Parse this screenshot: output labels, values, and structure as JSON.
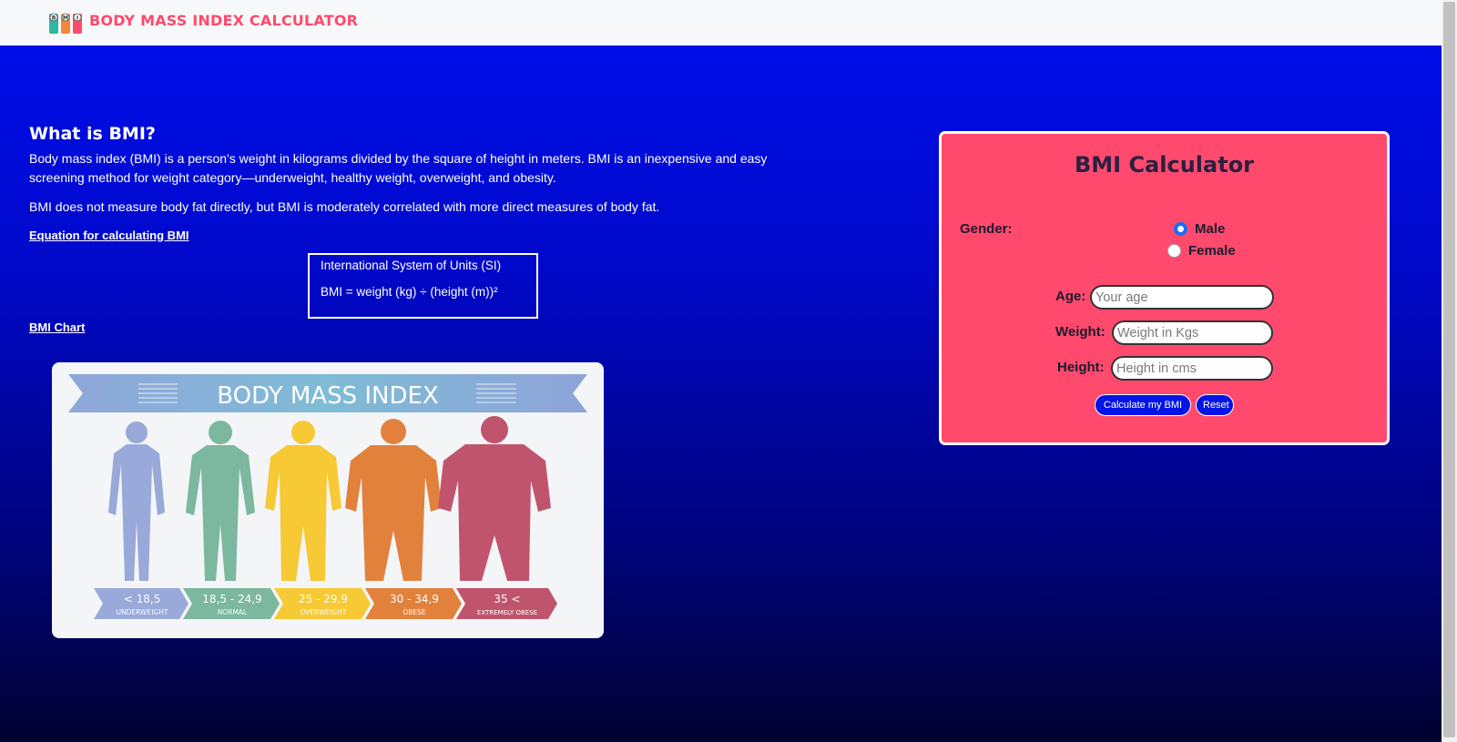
{
  "header": {
    "brand": "BODY MASS INDEX CALCULATOR",
    "logo_letters": "BMI",
    "brand_color": "#ff4a6e"
  },
  "intro": {
    "heading": "What is BMI?",
    "paragraph1": "Body mass index (BMI) is a person's weight in kilograms divided by the square of height in meters. BMI is an inexpensive and easy screening method for weight category—underweight, healthy weight, overweight, and obesity.",
    "paragraph2": "BMI does not measure body fat directly, but BMI is moderately correlated with more direct measures of body fat.",
    "equation_link": "Equation for calculating BMI",
    "equation": {
      "system": "International System of Units (SI)",
      "formula": "BMI = weight (kg) ÷ (height (m))²"
    },
    "chart_link": "BMI Chart"
  },
  "bmi_image": {
    "title": "BODY MASS INDEX",
    "categories": [
      {
        "range": "< 18,5",
        "label": "UNDERWEIGHT",
        "color": "#98a9da"
      },
      {
        "range": "18,5 - 24,9",
        "label": "NORMAL",
        "color": "#7cb79f"
      },
      {
        "range": "25 - 29,9",
        "label": "OVERWEIGHT",
        "color": "#f7c934"
      },
      {
        "range": "30 - 34,9",
        "label": "OBESE",
        "color": "#e2813c"
      },
      {
        "range": "35 <",
        "label": "EXTREMELY OBESE",
        "color": "#c0546c"
      }
    ]
  },
  "calculator": {
    "title": "BMI Calculator",
    "gender_label": "Gender:",
    "gender_options": [
      "Male",
      "Female"
    ],
    "gender_selected": "Male",
    "age_label": "Age:",
    "age_placeholder": "Your age",
    "weight_label": "Weight:",
    "weight_placeholder": "Weight in Kgs",
    "height_label": "Height:",
    "height_placeholder": "Height in cms",
    "calculate_button": "Calculate my BMI",
    "reset_button": "Reset",
    "panel_color": "#ff4a6e",
    "button_color": "#0414e6"
  }
}
